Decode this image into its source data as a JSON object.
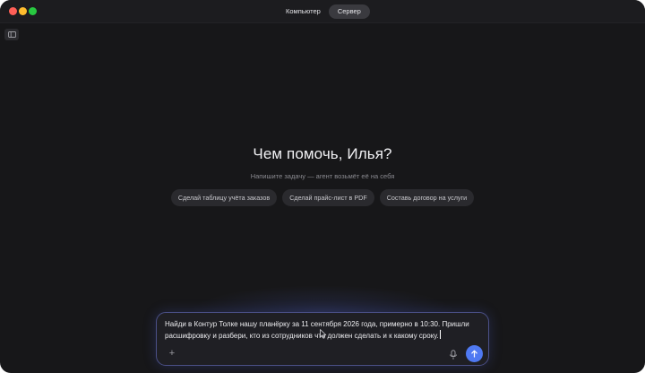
{
  "titlebar": {
    "tabs": [
      {
        "label": "Компьютер",
        "active": false
      },
      {
        "label": "Сервер",
        "active": true
      }
    ]
  },
  "hero": {
    "title": "Чем помочь, Илья?",
    "subtitle": "Напишите задачу — агент возьмёт её на себя"
  },
  "suggestions": [
    "Сделай таблицу учёта заказов",
    "Сделай прайс-лист в PDF",
    "Составь договор на услуги"
  ],
  "composer": {
    "text": "Найди в Контур Толке нашу планёрку за 11 сентября 2026 года, примерно в 10:30. Пришли расшифровку и разбери, кто из сотрудников что должен сделать и к какому сроку.",
    "add_label": "+"
  },
  "colors": {
    "window_bg": "#171719",
    "accent": "#4f79f2",
    "composer_border": "#4a4f86"
  },
  "icons": {
    "sidebar": "sidebar-toggle-icon",
    "mic": "microphone-icon",
    "send": "arrow-up-icon",
    "pointer": "mouse-pointer-icon"
  }
}
